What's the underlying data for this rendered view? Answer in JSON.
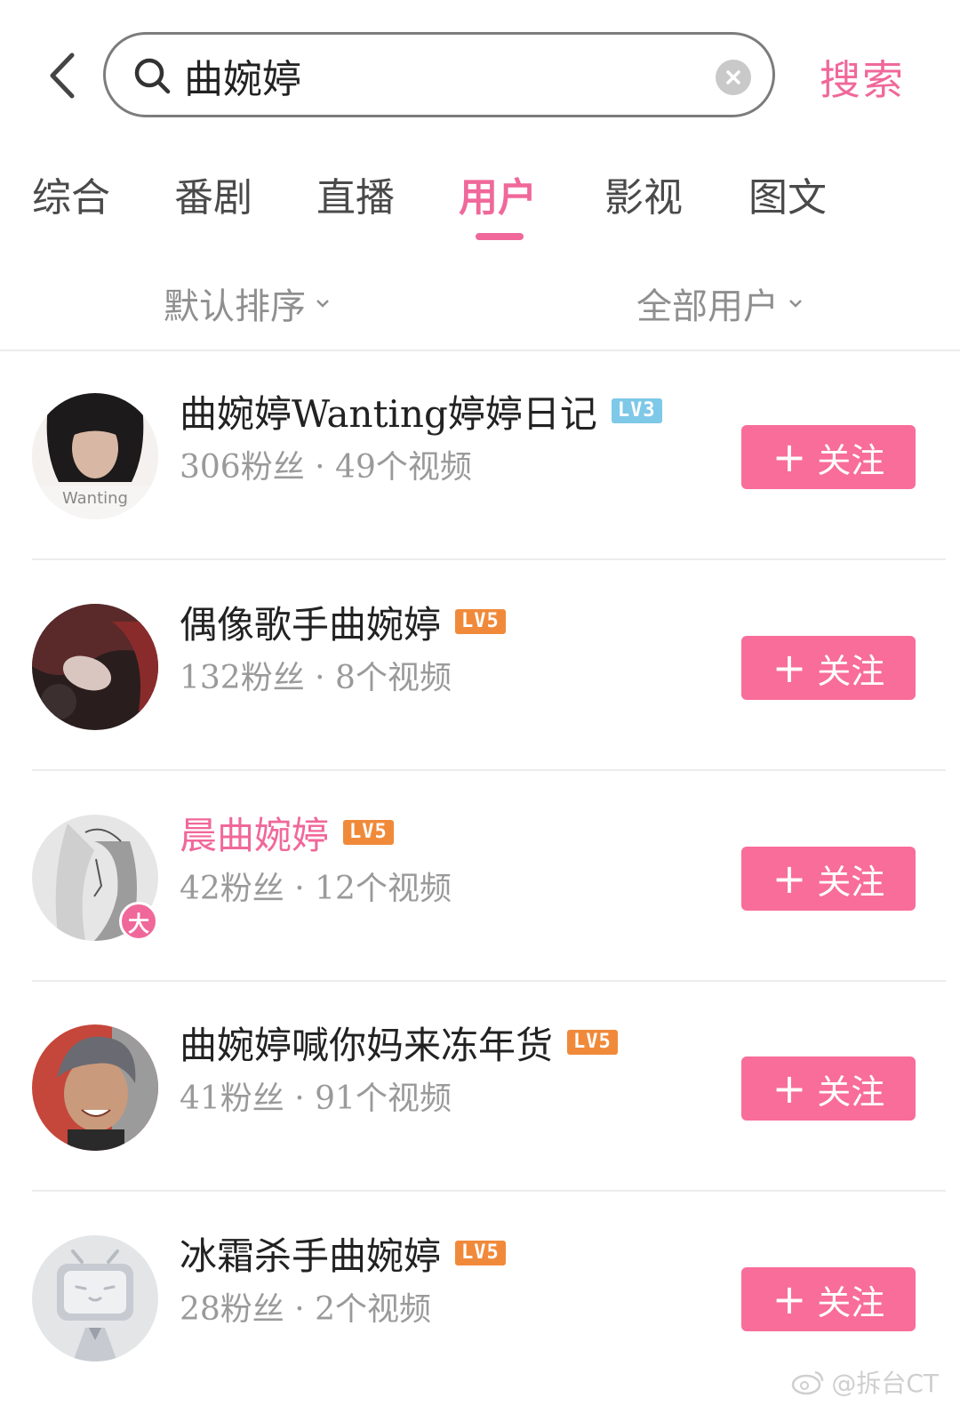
{
  "search": {
    "value": "曲婉婷",
    "button_label": "搜索"
  },
  "tabs": [
    {
      "label": "综合"
    },
    {
      "label": "番剧"
    },
    {
      "label": "直播"
    },
    {
      "label": "用户",
      "active": true
    },
    {
      "label": "影视"
    },
    {
      "label": "图文"
    }
  ],
  "filters": {
    "sort_label": "默认排序",
    "type_label": "全部用户"
  },
  "users": [
    {
      "name": "曲婉婷Wanting婷婷日记",
      "level": "LV3",
      "stats": "306粉丝 · 49个视频",
      "follow_label": "关注",
      "avatar": "photo-avatar",
      "avatar_caption": "Wanting"
    },
    {
      "name": "偶像歌手曲婉婷",
      "level": "LV5",
      "stats": "132粉丝 · 8个视频",
      "follow_label": "关注",
      "avatar": "photo-avatar"
    },
    {
      "name": "晨曲婉婷",
      "level": "LV5",
      "stats": "42粉丝 · 12个视频",
      "follow_label": "关注",
      "avatar": "sketch-avatar",
      "badge": "大",
      "name_color": "#f0689a"
    },
    {
      "name": "曲婉婷喊你妈来冻年货",
      "level": "LV5",
      "stats": "41粉丝 · 91个视频",
      "follow_label": "关注",
      "avatar": "photo-avatar"
    },
    {
      "name": "冰霜杀手曲婉婷",
      "level": "LV5",
      "stats": "28粉丝 · 2个视频",
      "follow_label": "关注",
      "avatar": "default-tv-avatar"
    }
  ],
  "watermark": "@拆台CT",
  "colors": {
    "accent": "#f0689a",
    "follow_button": "#f86d9a",
    "lv3": "#7ec8e8",
    "lv5": "#f08a3a"
  }
}
